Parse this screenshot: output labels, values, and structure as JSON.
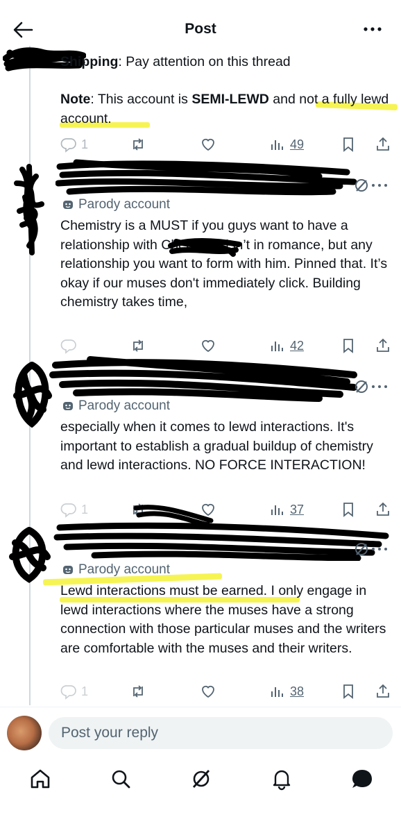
{
  "header": {
    "title": "Post"
  },
  "posts": [
    {
      "line1_bold": "Shipping",
      "line1_rest": ": Pay attention on this thread",
      "note_label": "Note",
      "note_text_1": ": This account is ",
      "note_bold": "SEMI-LEWD",
      "note_text_2": " and not a fully lewd account.",
      "replies": "1",
      "views": "49"
    },
    {
      "parody": "Parody account",
      "text": "Chemistry is a MUST if you guys want to have a relationship with Chemistry isn’t in romance, but any relationship you want to form with him. Pinned that. It’s okay if our muses don't immediately click. Building chemistry takes time,",
      "views": "42"
    },
    {
      "parody": "Parody account",
      "text": "especially when it comes to lewd interactions. It's important to establish a gradual buildup of chemistry and lewd interactions. NO FORCE INTERACTION!",
      "replies": "1",
      "views": "37"
    },
    {
      "parody": "Parody account",
      "text": "Lewd interactions must be earned. I only engage in lewd interactions where the muses have a strong connection with those particular muses and the writers are comfortable with the muses and their writers.",
      "replies": "1",
      "views": "38"
    }
  ],
  "reply": {
    "placeholder": "Post your reply"
  },
  "nav": [
    "home-icon",
    "search-icon",
    "grok-icon",
    "notifications-icon",
    "messages-icon"
  ],
  "colors": {
    "text": "#0f1419",
    "secondary": "#536471",
    "highlight": "#f5f236",
    "line": "#cfd9de"
  }
}
